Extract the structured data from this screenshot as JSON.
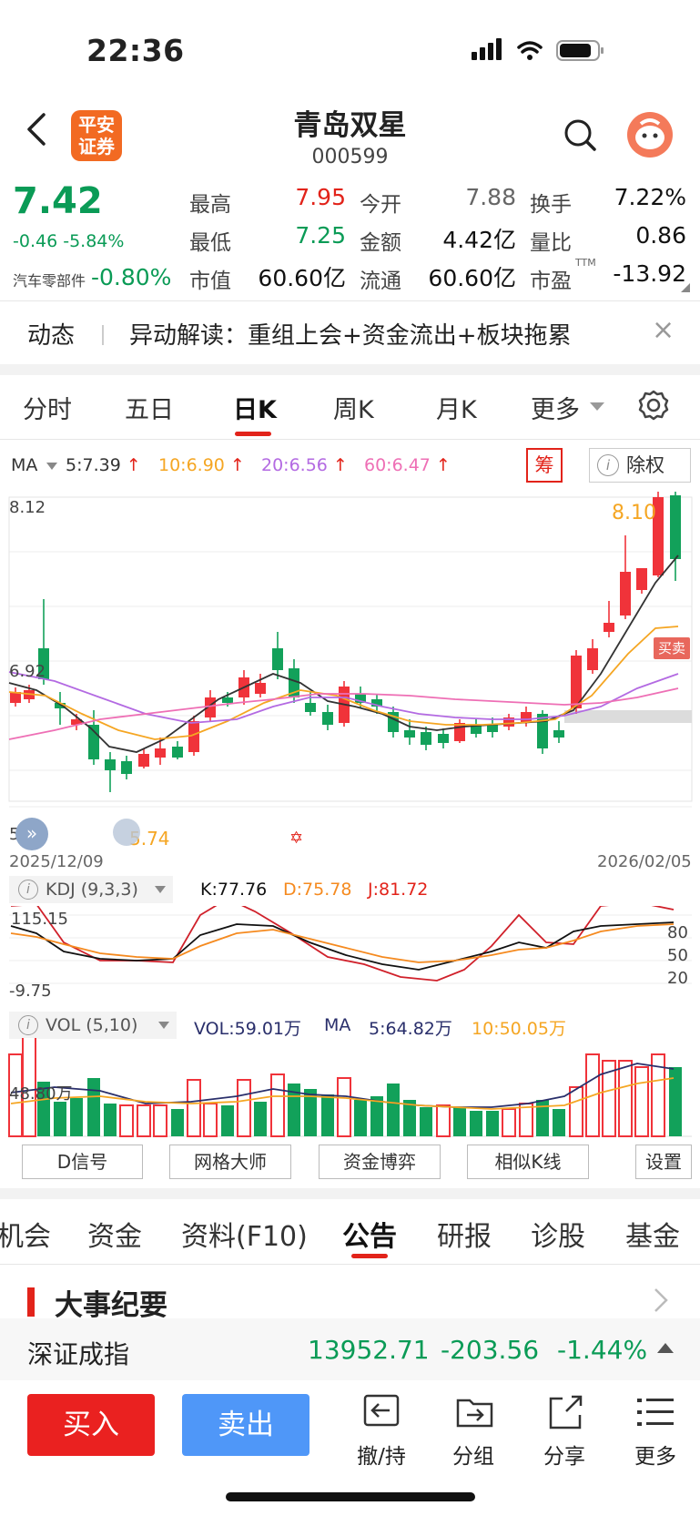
{
  "status": {
    "time": "22:36"
  },
  "header": {
    "title": "青岛双星",
    "code": "000599",
    "broker_logo": "平安证券"
  },
  "quote": {
    "price": "7.42",
    "change": "-0.46",
    "change_pct": "-5.84%",
    "sector_name": "汽车零部件",
    "sector_change": "-0.80%",
    "fields": [
      {
        "label": "最高",
        "value": "7.95"
      },
      {
        "label": "今开",
        "value": "7.88"
      },
      {
        "label": "换手",
        "value": "7.22%"
      },
      {
        "label": "最低",
        "value": "7.25"
      },
      {
        "label": "金额",
        "value": "4.42亿"
      },
      {
        "label": "量比",
        "value": "0.86"
      },
      {
        "label": "市值",
        "value": "60.60亿"
      },
      {
        "label": "流通",
        "value": "60.60亿"
      },
      {
        "label": "市盈",
        "value": "-13.92",
        "sup": "TTM"
      }
    ]
  },
  "news": {
    "tag": "动态",
    "text": "异动解读：重组上会+资金流出+板块拖累",
    "close": "×"
  },
  "chart_tabs": [
    "分时",
    "五日",
    "日K",
    "周K",
    "月K",
    "更多"
  ],
  "chart_tab_active": "日K",
  "ma_legend": {
    "label": "MA",
    "ma5": "5:7.39",
    "ma10": "10:6.90",
    "ma20": "20:6.56",
    "ma60": "60:6.47",
    "chou": "筹",
    "chuquan": "除权",
    "info_glyph": "i"
  },
  "kline": {
    "ymax_label": "8.12",
    "ymid_label": "6.92",
    "ymin_label": "5.72",
    "high_mark": "8.10",
    "low_mark": "5.74",
    "date_start": "2025/12/09",
    "date_end": "2026/02/05",
    "buy_sell_tag": "买卖",
    "colors": {
      "up": "#f0333a",
      "down": "#12a15a",
      "ma5": "#333333",
      "ma10": "#f5a623",
      "ma20": "#b36ae2",
      "ma60": "#ee6fb5"
    }
  },
  "kdj": {
    "label": "KDJ (9,3,3)",
    "k": "K:77.76",
    "d": "D:75.78",
    "j": "J:81.72",
    "top_label": "115.15",
    "bottom_label": "-9.75",
    "levels": [
      "80",
      "50",
      "20"
    ]
  },
  "vol": {
    "label": "VOL (5,10)",
    "vol": "VOL:59.01万",
    "ma_label": "MA",
    "ma5": "5:64.82万",
    "ma10": "10:50.05万",
    "axis_label": "48.80万"
  },
  "chart_buttons": [
    "D信号",
    "网格大师",
    "资金博弈",
    "相似K线",
    "设置"
  ],
  "bottom_tabs": [
    "机会",
    "资金",
    "资料(F10)",
    "公告",
    "研报",
    "诊股",
    "基金"
  ],
  "bottom_tab_active": "公告",
  "section": {
    "title": "大事纪要"
  },
  "index": {
    "name": "深证成指",
    "value": "13952.71",
    "change": "-203.56",
    "pct": "-1.44%"
  },
  "actions": {
    "buy": "买入",
    "sell": "卖出",
    "tools": [
      "撤/持",
      "分组",
      "分享",
      "更多"
    ]
  }
}
